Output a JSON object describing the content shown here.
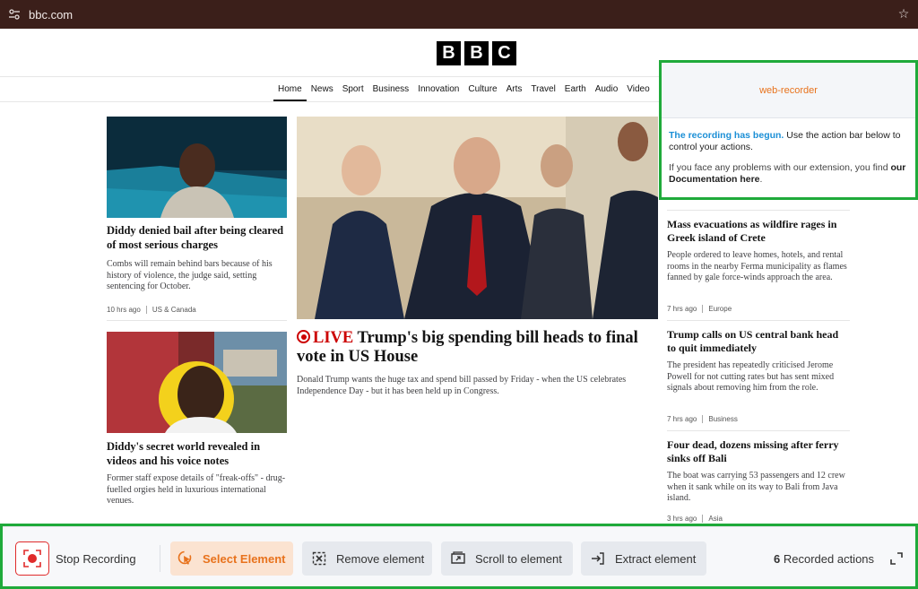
{
  "browser": {
    "url": "bbc.com"
  },
  "logo": {
    "letters": [
      "B",
      "B",
      "C"
    ]
  },
  "nav": {
    "items": [
      "Home",
      "News",
      "Sport",
      "Business",
      "Innovation",
      "Culture",
      "Arts",
      "Travel",
      "Earth",
      "Audio",
      "Video"
    ],
    "active": "Home"
  },
  "articles": {
    "diddy_bail": {
      "headline": "Diddy denied bail after being cleared of most serious charges",
      "summary": "Combs will remain behind bars because of his history of violence, the judge said, setting sentencing for October.",
      "time": "10 hrs ago",
      "tag": "US & Canada"
    },
    "diddy_secret": {
      "headline": "Diddy's secret world revealed in videos and his voice notes",
      "summary": "Former staff expose details of \"freak-offs\" - drug-fuelled orgies held in luxurious international venues."
    },
    "main": {
      "live_label": "LIVE",
      "headline": "Trump's big spending bill heads to final vote in US House",
      "summary": "Donald Trump wants the huge tax and spend bill passed by Friday - when the US celebrates Independence Day - but it has been held up in Congress."
    },
    "crete": {
      "headline": "Mass evacuations as wildfire rages in Greek island of Crete",
      "summary": "People ordered to leave homes, hotels, and rental rooms in the nearby Ferma municipality as flames fanned by gale force-winds approach the area.",
      "time": "7 hrs ago",
      "tag": "Europe"
    },
    "fed": {
      "headline": "Trump calls on US central bank head to quit immediately",
      "summary": "The president has repeatedly criticised Jerome Powell for not cutting rates but has sent mixed signals about removing him from the role.",
      "time": "7 hrs ago",
      "tag": "Business"
    },
    "bali": {
      "headline": "Four dead, dozens missing after ferry sinks off Bali",
      "summary": "The boat was carrying 53 passengers and 12 crew when it sank while on its way to Bali from Java island.",
      "time": "3 hrs ago",
      "tag": "Asia"
    }
  },
  "recorder": {
    "title": "web-recorder",
    "msg_highlight": "The recording has begun.",
    "msg_rest": " Use the action bar below to control your actions.",
    "help_text": "If you face any problems with our extension, you find ",
    "help_link": "our Documentation here",
    "help_end": "."
  },
  "action_bar": {
    "stop_label": "Stop Recording",
    "select_label": "Select Element",
    "remove_label": "Remove element",
    "scroll_label": "Scroll to element",
    "extract_label": "Extract element",
    "count": "6",
    "count_label": "Recorded actions"
  },
  "colors": {
    "accent_orange": "#e8721c",
    "green_frame": "#1faa3a",
    "live_red": "#cc0000",
    "link_blue": "#1b8fd6"
  }
}
